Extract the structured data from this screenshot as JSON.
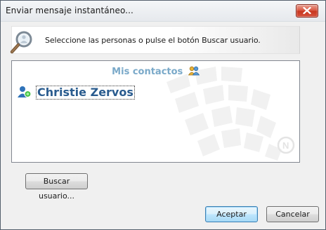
{
  "window": {
    "title": "Enviar mensaje instantáneo..."
  },
  "banner": {
    "icon": "magnifier-person-icon",
    "text": "Seleccione las personas o pulse el botón Buscar usuario."
  },
  "contacts": {
    "group_title": "Mis contactos",
    "group_icon": "people-group-icon",
    "items": [
      {
        "name": "Christie Zervos",
        "status": "online",
        "icon": "user-online-icon"
      }
    ]
  },
  "buttons": {
    "search": "Buscar usuario...",
    "accept": "Aceptar",
    "cancel": "Cancelar"
  },
  "colors": {
    "accent": "#2a5c8f",
    "group_title": "#7aa9c9",
    "close_button": "#c7361f"
  }
}
